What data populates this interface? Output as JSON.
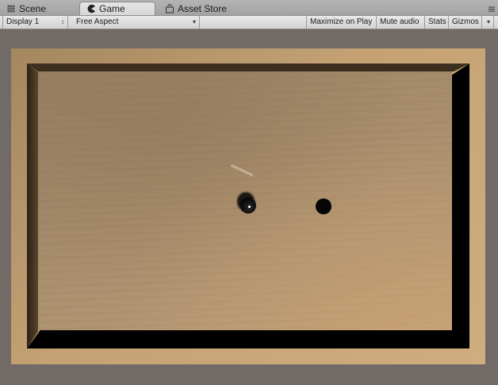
{
  "tabs": [
    {
      "label": "Scene",
      "icon": "grid-icon",
      "active": false
    },
    {
      "label": "Game",
      "icon": "pacman-icon",
      "active": true
    },
    {
      "label": "Asset Store",
      "icon": "bag-icon",
      "active": false
    }
  ],
  "toolbar": {
    "display": "Display 1",
    "aspect": "Free Aspect",
    "maximize": "Maximize on Play",
    "mute": "Mute audio",
    "stats": "Stats",
    "gizmos": "Gizmos"
  },
  "scene": {
    "board_color": "#c4a274",
    "floor_color": "#a68c6c",
    "ball_color": "#050505",
    "hole_color": "#050505"
  }
}
